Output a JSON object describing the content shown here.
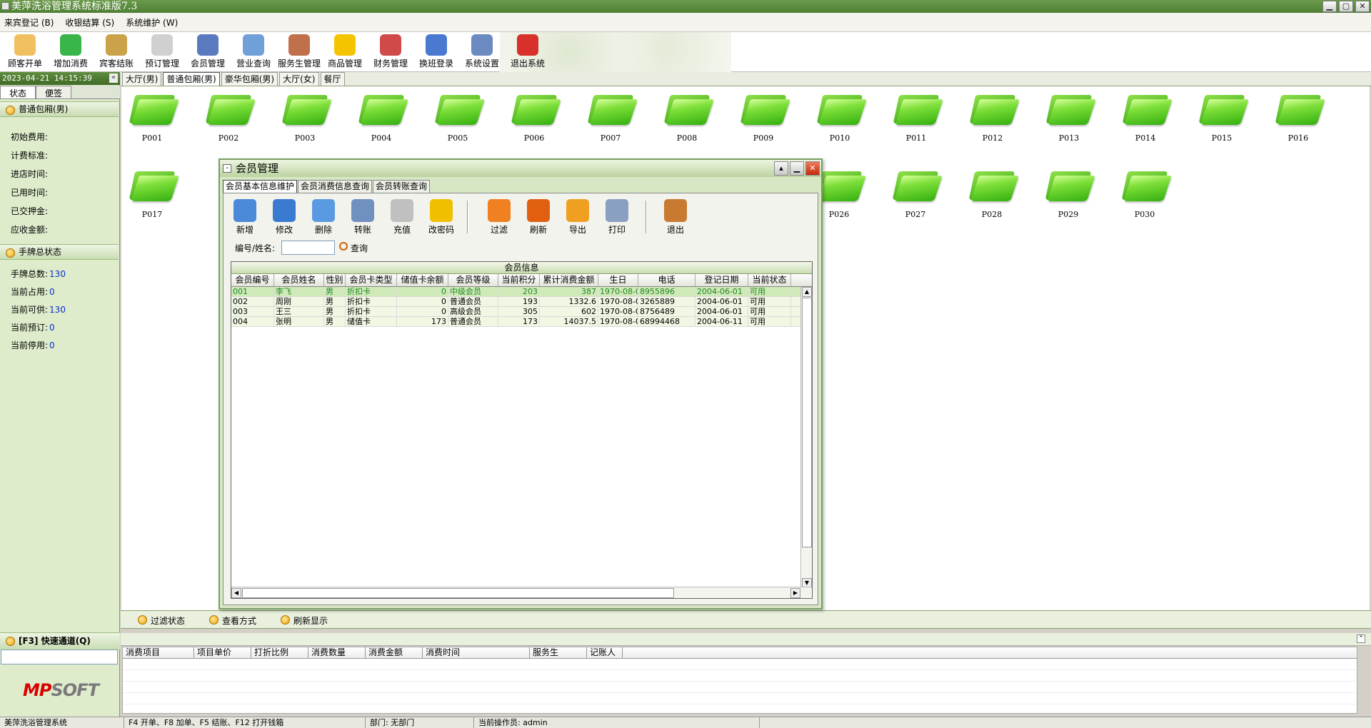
{
  "window": {
    "title": "美萍洗浴管理系统标准版7.3",
    "buttons": [
      "▁",
      "▢",
      "✕"
    ]
  },
  "menu": [
    "来宾登记 (B)",
    "收银结算 (S)",
    "系统维护 (W)"
  ],
  "toolbar": [
    {
      "label": "顾客开单",
      "icon": "key-icon",
      "color": "#f0c060"
    },
    {
      "label": "增加消费",
      "icon": "green-box-icon",
      "color": "#39b54a"
    },
    {
      "label": "宾客结账",
      "icon": "money-bag-icon",
      "color": "#c9a24a"
    },
    {
      "label": "预订管理",
      "icon": "clock-icon",
      "color": "#d0d0d0"
    },
    {
      "label": "会员管理",
      "icon": "member-icon",
      "color": "#5a7abf"
    },
    {
      "label": "营业查询",
      "icon": "magnifier-icon",
      "color": "#6fa0d8"
    },
    {
      "label": "服务生管理",
      "icon": "people-icon",
      "color": "#c0704a"
    },
    {
      "label": "商品管理",
      "icon": "star-icon",
      "color": "#f5c400"
    },
    {
      "label": "财务管理",
      "icon": "finance-icon",
      "color": "#d04a4a"
    },
    {
      "label": "换班登录",
      "icon": "shift-icon",
      "color": "#4a7ad0"
    },
    {
      "label": "系统设置",
      "icon": "settings-icon",
      "color": "#6a8ac0"
    },
    {
      "label": "退出系统",
      "icon": "power-icon",
      "color": "#d8302a"
    }
  ],
  "left": {
    "datetime": "2023-04-21 14:15:39",
    "tabs": [
      "状态",
      "便签"
    ],
    "room_group": "普通包厢(男)",
    "room_fields": [
      "初始费用:",
      "计费标准:",
      "进店时间:",
      "已用时间:",
      "已交押金:",
      "应收金额:"
    ],
    "tag_group": "手牌总状态",
    "tag_fields": [
      {
        "label": "手牌总数:",
        "value": "130"
      },
      {
        "label": "当前占用:",
        "value": "0"
      },
      {
        "label": "当前可供:",
        "value": "130"
      },
      {
        "label": "当前预订:",
        "value": "0"
      },
      {
        "label": "当前停用:",
        "value": "0"
      }
    ],
    "quick": "[F3] 快速通道(Q)",
    "logo_red": "MP",
    "logo_gray": "SOFT"
  },
  "main_tabs": [
    "大厅(男)",
    "普通包厢(男)",
    "豪华包厢(男)",
    "大厅(女)",
    "餐厅"
  ],
  "rooms": [
    "P001",
    "P002",
    "P003",
    "P004",
    "P005",
    "P006",
    "P007",
    "P008",
    "P009",
    "P010",
    "P011",
    "P012",
    "P013",
    "P014",
    "P015",
    "P016",
    "P017",
    "P026",
    "P027",
    "P028",
    "P029",
    "P030"
  ],
  "bottom_bar": [
    "过滤状态",
    "查看方式",
    "刷新显示"
  ],
  "consume_columns": [
    "消费项目",
    "项目单价",
    "打折比例",
    "消费数量",
    "消费金额",
    "消费时间",
    "服务生",
    "记账人"
  ],
  "status": [
    "美萍洗浴管理系统",
    "F4 开单、F8 加单、F5 结账、F12 打开钱箱",
    "部门: 无部门",
    "当前操作员: admin"
  ],
  "dialog": {
    "title": "会员管理",
    "tabs": [
      "会员基本信息维护",
      "会员消费信息查询",
      "会员转账查询"
    ],
    "toolbar": [
      {
        "label": "新增",
        "icon": "add-icon",
        "color": "#4a8ad8"
      },
      {
        "label": "修改",
        "icon": "edit-icon",
        "color": "#3a7ad0"
      },
      {
        "label": "删除",
        "icon": "delete-icon",
        "color": "#5a9ae0"
      },
      {
        "label": "转账",
        "icon": "transfer-icon",
        "color": "#7090c0"
      },
      {
        "label": "充值",
        "icon": "recharge-icon",
        "color": "#c0c0c0"
      },
      {
        "label": "改密码",
        "icon": "key-icon",
        "color": "#f0c000"
      },
      {
        "label": "过滤",
        "icon": "filter-icon",
        "color": "#f08020"
      },
      {
        "label": "刷新",
        "icon": "refresh-icon",
        "color": "#e06010"
      },
      {
        "label": "导出",
        "icon": "export-icon",
        "color": "#f0a020"
      },
      {
        "label": "打印",
        "icon": "printer-icon",
        "color": "#8aa0c0"
      },
      {
        "label": "退出",
        "icon": "exit-door-icon",
        "color": "#c87a30"
      }
    ],
    "search_label": "编号/姓名:",
    "search_value": "",
    "query_label": "查询",
    "grid_title": "会员信息",
    "columns": [
      "会员编号",
      "会员姓名",
      "性别",
      "会员卡类型",
      "储值卡余额",
      "会员等级",
      "当前积分",
      "累计消费金额",
      "生日",
      "电话",
      "登记日期",
      "当前状态"
    ],
    "rows": [
      [
        "001",
        "李飞",
        "男",
        "折扣卡",
        "0",
        "中级会员",
        "203",
        "387",
        "1970-08-0",
        "8955896",
        "2004-06-01",
        "可用"
      ],
      [
        "002",
        "周刚",
        "男",
        "折扣卡",
        "0",
        "普通会员",
        "193",
        "1332.6",
        "1970-08-0",
        "3265889",
        "2004-06-01",
        "可用"
      ],
      [
        "003",
        "王三",
        "男",
        "折扣卡",
        "0",
        "高级会员",
        "305",
        "602",
        "1970-08-0",
        "8756489",
        "2004-06-01",
        "可用"
      ],
      [
        "004",
        "张明",
        "男",
        "储值卡",
        "173",
        "普通会员",
        "173",
        "14037.5",
        "1970-08-0",
        "68994468",
        "2004-06-11",
        "可用"
      ]
    ]
  }
}
